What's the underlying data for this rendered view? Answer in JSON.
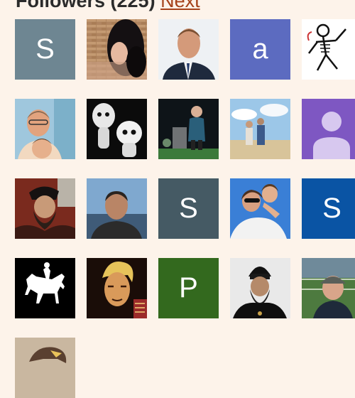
{
  "header": {
    "title": "Followers (225)",
    "next_label": "Next"
  },
  "colors": {
    "background": "#fdf3ea",
    "link": "#a5421b"
  },
  "avatars": [
    {
      "name": "avatar-s-gray",
      "kind": "letter",
      "letter": "S",
      "color": "#6e8692"
    },
    {
      "name": "avatar-woman-dark-hair",
      "kind": "photo"
    },
    {
      "name": "avatar-man-suit",
      "kind": "photo"
    },
    {
      "name": "avatar-a-indigo",
      "kind": "letter",
      "letter": "a",
      "color": "#5c6bc0"
    },
    {
      "name": "avatar-skeleton",
      "kind": "photo"
    },
    {
      "name": "avatar-man-and-boy",
      "kind": "photo"
    },
    {
      "name": "avatar-kodama",
      "kind": "photo"
    },
    {
      "name": "avatar-speaker-stage",
      "kind": "photo"
    },
    {
      "name": "avatar-couple-beach",
      "kind": "photo"
    },
    {
      "name": "avatar-default-person",
      "kind": "default",
      "color": "#7e57c2"
    },
    {
      "name": "avatar-bearded-painting",
      "kind": "photo"
    },
    {
      "name": "avatar-man-harbor",
      "kind": "photo"
    },
    {
      "name": "avatar-s-slate",
      "kind": "letter",
      "letter": "S",
      "color": "#455a64"
    },
    {
      "name": "avatar-parent-child",
      "kind": "photo"
    },
    {
      "name": "avatar-s-blue",
      "kind": "letter",
      "letter": "S",
      "color": "#0a54a4"
    },
    {
      "name": "avatar-horse-rider",
      "kind": "photo"
    },
    {
      "name": "avatar-blond-man-poster",
      "kind": "photo"
    },
    {
      "name": "avatar-p-green",
      "kind": "letter",
      "letter": "P",
      "color": "#33691e"
    },
    {
      "name": "avatar-bishop",
      "kind": "photo"
    },
    {
      "name": "avatar-man-stadium",
      "kind": "photo"
    },
    {
      "name": "avatar-eagle",
      "kind": "photo"
    }
  ]
}
